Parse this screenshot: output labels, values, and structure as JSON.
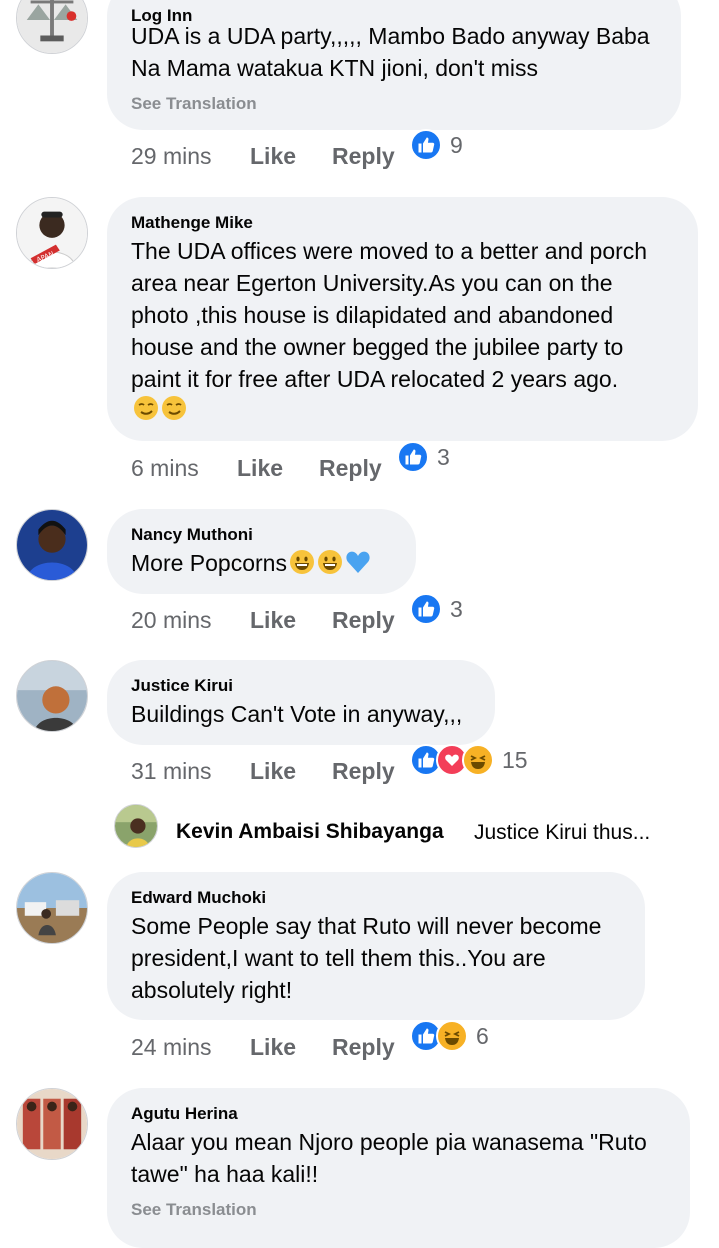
{
  "comments": [
    {
      "author": "Log Inn",
      "text": "UDA is a UDA party,,,,, Mambo Bado anyway Baba\nNa Mama watakua KTN jioni, don't miss",
      "see_translation": "See Translation",
      "time": "29 mins",
      "like_label": "Like",
      "reply_label": "Reply",
      "reaction_count": "9",
      "reactions": [
        "like"
      ]
    },
    {
      "author": "Mathenge Mike",
      "text": "The UDA offices were moved to a better and porch\narea near Egerton University.As you can on the\nphoto ,this house is dilapidated and abandoned\nhouse and the owner begged the jubilee party to\npaint it for free after UDA relocated 2 years ago.",
      "emojis": [
        "smirk-emoji",
        "smirk-emoji"
      ],
      "time": "6 mins",
      "like_label": "Like",
      "reply_label": "Reply",
      "reaction_count": "3",
      "reactions": [
        "like"
      ]
    },
    {
      "author": "Nancy Muthoni",
      "text": "More Popcorns",
      "emojis": [
        "grin-emoji",
        "grin-emoji",
        "blue-heart-emoji"
      ],
      "time": "20 mins",
      "like_label": "Like",
      "reply_label": "Reply",
      "reaction_count": "3",
      "reactions": [
        "like"
      ]
    },
    {
      "author": "Justice Kirui",
      "text": "Buildings Can't Vote in anyway,,,",
      "time": "31 mins",
      "like_label": "Like",
      "reply_label": "Reply",
      "reaction_count": "15",
      "reactions": [
        "like",
        "love",
        "haha"
      ]
    },
    {
      "author": "Edward Muchoki",
      "text": "Some People say that Ruto will never become\npresident,I want to tell them this..You are\nabsolutely right!",
      "time": "24 mins",
      "like_label": "Like",
      "reply_label": "Reply",
      "reaction_count": "6",
      "reactions": [
        "like",
        "haha"
      ]
    },
    {
      "author": "Agutu Herina",
      "text": "Alaar you mean Njoro people pia wanasema \"Ruto\ntawe\" ha haa kali!!",
      "see_translation": "See Translation"
    }
  ],
  "reply_preview": {
    "author": "Kevin Ambaisi Shibayanga",
    "snippet": "Justice Kirui thus..."
  },
  "colors": {
    "bubble": "#f0f2f5",
    "meta_text": "#65676b",
    "like_blue": "#1877f2",
    "love_red": "#f33e58",
    "haha_yellow": "#f7b125"
  }
}
